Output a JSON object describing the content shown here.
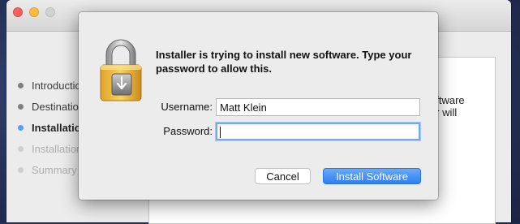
{
  "installer_window": {
    "steps": [
      {
        "label": "Introduction",
        "state": "done"
      },
      {
        "label": "Destination Select",
        "state": "done"
      },
      {
        "label": "Installation",
        "state": "current"
      },
      {
        "label": "Installation",
        "state": "future"
      },
      {
        "label": "Summary",
        "state": "future"
      }
    ],
    "pane_text_line1": "oftware",
    "pane_text_line2": "er will"
  },
  "dialog": {
    "message": "Installer is trying to install new software. Type your password to allow this.",
    "username_label": "Username:",
    "username_value": "Matt Klein",
    "password_label": "Password:",
    "password_value": "",
    "cancel_label": "Cancel",
    "install_label": "Install Software",
    "icon": "padlock-installer-icon"
  },
  "colors": {
    "accent": "#3a86f5",
    "focus_ring": "#74a9ee",
    "current_step_dot": "#5d9ef3"
  }
}
